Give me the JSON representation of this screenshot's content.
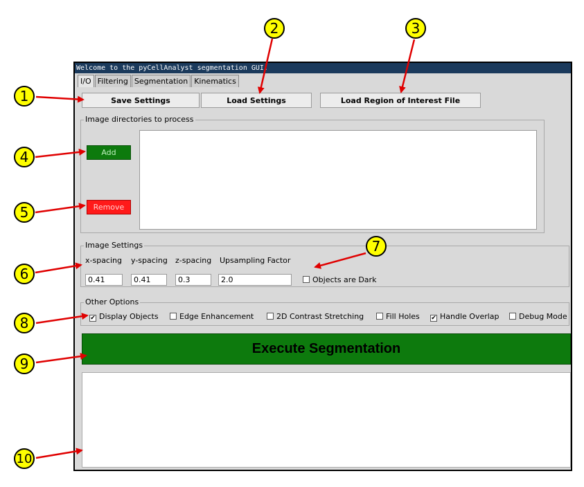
{
  "window": {
    "title": "Welcome to the pyCellAnalyst segmentation GUI."
  },
  "tabs": [
    "I/O",
    "Filtering",
    "Segmentation",
    "Kinematics"
  ],
  "toolbar": {
    "save_label": "Save Settings",
    "load_label": "Load Settings",
    "roi_label": "Load Region of Interest File"
  },
  "dirs": {
    "title": "Image directories to process",
    "add_label": "Add",
    "remove_label": "Remove"
  },
  "image_settings": {
    "title": "Image Settings",
    "x_label": "x-spacing",
    "x_value": "0.41",
    "y_label": "y-spacing",
    "y_value": "0.41",
    "z_label": "z-spacing",
    "z_value": "0.3",
    "up_label": "Upsampling Factor",
    "up_value": "2.0",
    "dark_label": "Objects are Dark",
    "dark_checked": false
  },
  "other_options": {
    "title": "Other Options",
    "items": [
      {
        "label": "Display Objects",
        "checked": true
      },
      {
        "label": "Edge Enhancement",
        "checked": false
      },
      {
        "label": "2D Contrast Stretching",
        "checked": false
      },
      {
        "label": "Fill Holes",
        "checked": false
      },
      {
        "label": "Handle Overlap",
        "checked": true
      },
      {
        "label": "Debug Mode",
        "checked": false
      }
    ]
  },
  "execute": {
    "label": "Execute Segmentation"
  },
  "callouts": [
    "1",
    "2",
    "3",
    "4",
    "5",
    "6",
    "7",
    "8",
    "9",
    "10"
  ],
  "colors": {
    "green": "#0d7a0d",
    "red": "#ff1a1a",
    "callout": "#ffff00",
    "arrow": "#e00000"
  }
}
